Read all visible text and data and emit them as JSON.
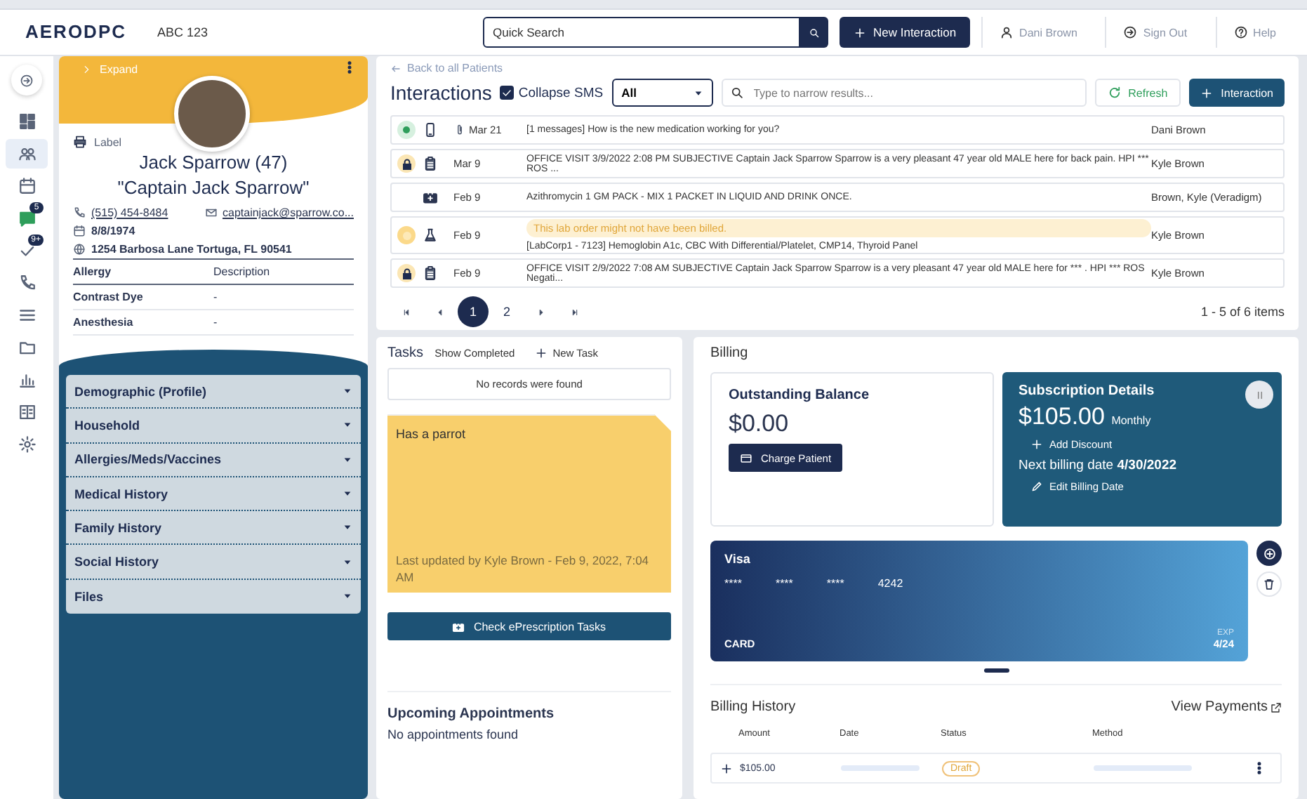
{
  "header": {
    "logo": "AERODPC",
    "account": "ABC 123",
    "search": {
      "placeholder": "Quick Search"
    },
    "new_interaction": "New Interaction",
    "user": "Dani Brown",
    "sign_out": "Sign Out",
    "help": "Help"
  },
  "nav": [
    {
      "kind": "collapse",
      "selected": false
    },
    {
      "kind": "dashboard",
      "selected": false
    },
    {
      "kind": "patients",
      "selected": true
    },
    {
      "kind": "calendar",
      "selected": false
    },
    {
      "kind": "messages",
      "selected": false,
      "badge": "5"
    },
    {
      "kind": "tasks",
      "selected": false,
      "badge": "9+"
    },
    {
      "kind": "phone",
      "selected": false
    },
    {
      "kind": "list",
      "selected": false
    },
    {
      "kind": "folder",
      "selected": false
    },
    {
      "kind": "reports",
      "selected": false
    },
    {
      "kind": "book",
      "selected": false
    },
    {
      "kind": "settings",
      "selected": false
    }
  ],
  "patient": {
    "expand": "Expand",
    "label": "Label",
    "name": "Jack Sparrow (47)",
    "nickname": "\"Captain Jack Sparrow\"",
    "phone": "(515) 454-8484",
    "email": "captainjack@sparrow.co...",
    "dob": "8/8/1974",
    "address": "1254 Barbosa Lane Tortuga, FL 90541",
    "allergies": {
      "columns": [
        "Allergy",
        "Description"
      ],
      "rows": [
        [
          "Contrast Dye",
          "-"
        ],
        [
          "Anesthesia",
          "-"
        ]
      ]
    },
    "sections": [
      "Demographic (Profile)",
      "Household",
      "Allergies/Meds/Vaccines",
      "Medical History",
      "Family History",
      "Social History",
      "Files"
    ]
  },
  "interactions": {
    "back": "Back to all Patients",
    "title": "Interactions",
    "collapse_sms": {
      "label": "Collapse SMS",
      "checked": true
    },
    "filter": "All",
    "search": {
      "placeholder": "Type to narrow results..."
    },
    "refresh": "Refresh",
    "add": "Interaction",
    "rows": [
      {
        "kind": "sms",
        "locked": false,
        "attachment": true,
        "date": "Mar 21",
        "text": "[1 messages] How is the new medication working for you?",
        "author": "Dani Brown"
      },
      {
        "kind": "visit",
        "locked": true,
        "attachment": false,
        "date": "Mar 9",
        "text": "OFFICE VISIT 3/9/2022 2:08 PM SUBJECTIVE Captain Jack Sparrow Sparrow is a very pleasant 47 year old MALE here for back pain. HPI *** ROS ...",
        "author": "Kyle Brown"
      },
      {
        "kind": "prescription",
        "locked": false,
        "attachment": false,
        "date": "Feb 9",
        "text": "Azithromycin 1 GM PACK - MIX 1 PACKET IN LIQUID AND DRINK ONCE.",
        "author": "Brown, Kyle (Veradigm)"
      },
      {
        "kind": "lab",
        "locked": false,
        "attachment": false,
        "date": "Feb 9",
        "warning": "This lab order might not have been billed.",
        "text": "[LabCorp1 - 7123] Hemoglobin A1c, CBC With Differential/Platelet, CMP14, Thyroid Panel",
        "author": "Kyle Brown"
      },
      {
        "kind": "visit",
        "locked": true,
        "attachment": false,
        "date": "Feb 9",
        "text": "OFFICE VISIT 2/9/2022 7:08 AM SUBJECTIVE Captain Jack Sparrow Sparrow is a very pleasant 47 year old MALE here for *** . HPI *** ROS Negati...",
        "author": "Kyle Brown"
      }
    ],
    "pages": [
      {
        "label": "1",
        "selected": true
      },
      {
        "label": "2",
        "selected": false
      }
    ],
    "summary": "1 - 5 of 6 items"
  },
  "tasks": {
    "title": "Tasks",
    "show_completed": "Show Completed",
    "new_task": "New Task",
    "empty": "No records were found",
    "note": {
      "text": "Has a parrot",
      "updated": "Last updated by Kyle Brown - Feb 9, 2022, 7:04 AM"
    },
    "eprescription": "Check ePrescription Tasks",
    "upcoming": {
      "title": "Upcoming Appointments",
      "empty": "No appointments found"
    }
  },
  "billing": {
    "title": "Billing",
    "balance": {
      "title": "Outstanding Balance",
      "amount": "$0.00",
      "button": "Charge Patient"
    },
    "subscription": {
      "title": "Subscription Details",
      "amount": "$105.00",
      "period": "Monthly",
      "add_discount": "Add Discount",
      "next_label": "Next billing date",
      "next_date": "4/30/2022",
      "edit": "Edit Billing Date"
    },
    "card": {
      "brand": "Visa",
      "groups": [
        "****",
        "****",
        "****",
        "4242"
      ],
      "type": "CARD",
      "exp_label": "EXP",
      "exp": "4/24"
    },
    "history": {
      "title": "Billing History",
      "view": "View Payments",
      "columns": [
        "Amount",
        "Date",
        "Status",
        "Method"
      ],
      "rows": [
        {
          "amount": "$105.00",
          "status": "Draft"
        }
      ]
    }
  }
}
